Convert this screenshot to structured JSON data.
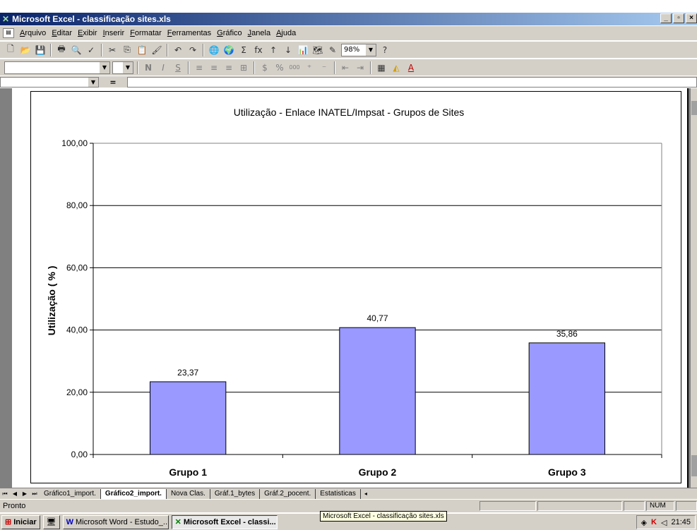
{
  "window": {
    "title": "Microsoft Excel - classificação sites.xls"
  },
  "menu": [
    "Arquivo",
    "Editar",
    "Exibir",
    "Inserir",
    "Formatar",
    "Ferramentas",
    "Gráfico",
    "Janela",
    "Ajuda"
  ],
  "toolbar": {
    "zoom": "98%",
    "font_bold": "N",
    "font_italic": "I",
    "font_underline": "S",
    "percent": "%",
    "thousands": "000",
    "sigma": "Σ",
    "fx": "fx"
  },
  "formula": {
    "equals": "="
  },
  "sheet_tabs": [
    "Gráfico1_import.",
    "Gráfico2_import.",
    "Nova Clas.",
    "Gráf.1_bytes",
    "Gráf.2_pocent.",
    "Estatisticas"
  ],
  "active_tab": "Gráfico2_import.",
  "status": {
    "ready": "Pronto",
    "num": "NUM"
  },
  "taskbar": {
    "start": "Iniciar",
    "items": [
      "Microsoft Word - Estudo_...",
      "Microsoft Excel - classi..."
    ],
    "time": "21:45",
    "tooltip": "Microsoft Excel - classificação sites.xls"
  },
  "chart_data": {
    "type": "bar",
    "title": "Utilização - Enlace INATEL/Impsat - Grupos de Sites",
    "xlabel": "",
    "ylabel": "Utilização ( % )",
    "categories": [
      "Grupo 1",
      "Grupo 2",
      "Grupo 3"
    ],
    "values": [
      23.37,
      40.77,
      35.86
    ],
    "value_labels": [
      "23,37",
      "40,77",
      "35,86"
    ],
    "ylim": [
      0,
      100
    ],
    "yticks": [
      "0,00",
      "20,00",
      "40,00",
      "60,00",
      "80,00",
      "100,00"
    ],
    "bar_color": "#9999ff",
    "grid": true
  }
}
